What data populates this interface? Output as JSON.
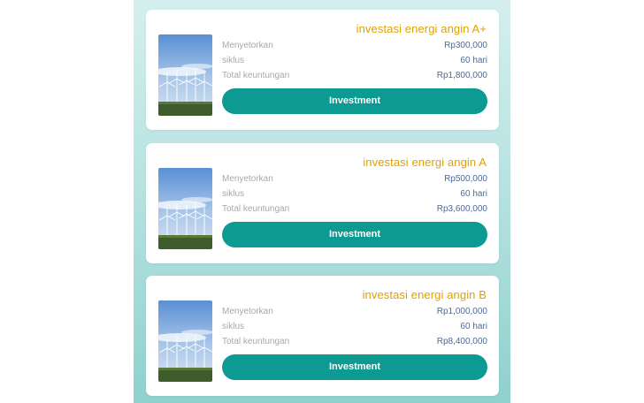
{
  "products": [
    {
      "title": "investasi energi angin A+",
      "deposit_label": "Menyetorkan",
      "deposit_value": "Rp300,000",
      "cycle_label": "siklus",
      "cycle_value": "60 hari",
      "profit_label": "Total keuntungan",
      "profit_value": "Rp1,800,000",
      "button_label": "Investment"
    },
    {
      "title": "investasi energi angin A",
      "deposit_label": "Menyetorkan",
      "deposit_value": "Rp500,000",
      "cycle_label": "siklus",
      "cycle_value": "60 hari",
      "profit_label": "Total keuntungan",
      "profit_value": "Rp3,600,000",
      "button_label": "Investment"
    },
    {
      "title": "investasi energi angin B",
      "deposit_label": "Menyetorkan",
      "deposit_value": "Rp1,000,000",
      "cycle_label": "siklus",
      "cycle_value": "60 hari",
      "profit_label": "Total keuntungan",
      "profit_value": "Rp8,400,000",
      "button_label": "Investment"
    }
  ],
  "colors": {
    "title": "#e0a100",
    "value": "#4e6a98",
    "button": "#0c9a93"
  },
  "icons": {
    "product_image": "wind-turbine-photo"
  }
}
